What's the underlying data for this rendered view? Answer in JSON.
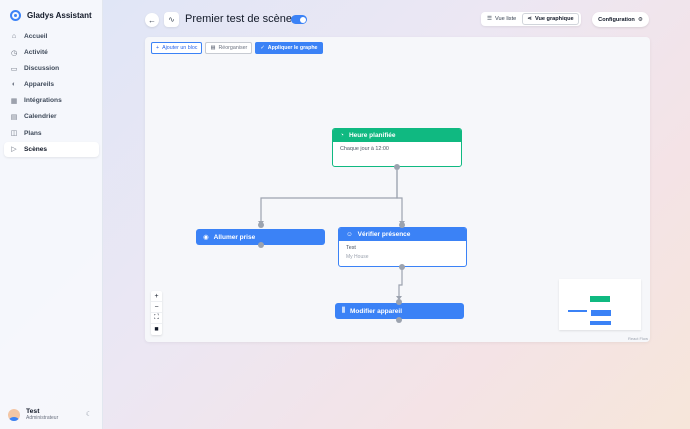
{
  "app": {
    "name": "Gladys Assistant"
  },
  "sidebar": {
    "items": [
      {
        "label": "Accueil",
        "icon": "home-icon",
        "glyph": "⌂"
      },
      {
        "label": "Activité",
        "icon": "activity-icon",
        "glyph": "◷"
      },
      {
        "label": "Discussion",
        "icon": "chat-icon",
        "glyph": "▭"
      },
      {
        "label": "Appareils",
        "icon": "devices-icon",
        "glyph": "◐"
      },
      {
        "label": "Intégrations",
        "icon": "integrations-icon",
        "glyph": "▦"
      },
      {
        "label": "Calendrier",
        "icon": "calendar-icon",
        "glyph": "▤"
      },
      {
        "label": "Plans",
        "icon": "map-icon",
        "glyph": "◫"
      },
      {
        "label": "Scènes",
        "icon": "play-icon",
        "glyph": "▷",
        "active": true
      }
    ]
  },
  "user": {
    "name": "Test",
    "role": "Administrateur"
  },
  "header": {
    "title": "Premier test de scène",
    "enabled": true,
    "view_list": "Vue liste",
    "view_graph": "Vue graphique",
    "active_view": "graph",
    "config": "Configuration"
  },
  "toolbar": {
    "add_block": "Ajouter un bloc",
    "reorganize": "Réorganiser",
    "apply_graph": "Appliquer le graphe"
  },
  "nodes": {
    "time": {
      "title": "Heure planifiée",
      "detail": "Chaque jour à 12:00",
      "color": "#10b981"
    },
    "allumer": {
      "title": "Allumer prise",
      "color": "#3b82f6"
    },
    "verifier": {
      "title": "Vérifier présence",
      "user": "Test",
      "house": "My House",
      "color": "#3b82f6"
    },
    "modifier": {
      "title": "Modifier appareil",
      "color": "#3b82f6"
    }
  },
  "canvas_controls": [
    "zoom-in",
    "zoom-out",
    "fit-view",
    "lock"
  ],
  "attribution": "React Flow",
  "colors": {
    "accent": "#3b82f6",
    "trigger": "#10b981",
    "edge": "#9ca3af"
  }
}
